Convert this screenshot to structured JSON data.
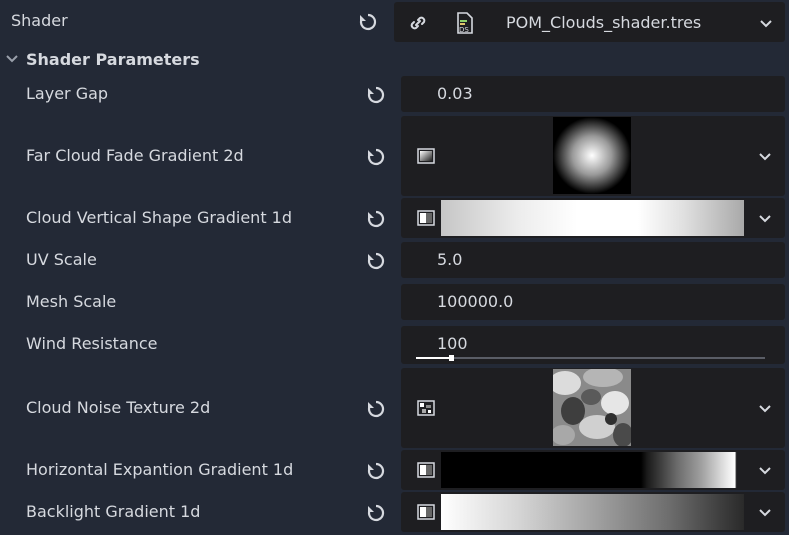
{
  "shader": {
    "label": "Shader",
    "resource_name": "POM_Clouds_shader.tres",
    "icons": [
      "revert-icon",
      "link-icon",
      "shader-file-icon",
      "chevron-down-icon"
    ]
  },
  "section": {
    "title": "Shader Parameters",
    "icon": "chevron-down-icon"
  },
  "params": {
    "layer_gap": {
      "label": "Layer Gap",
      "value": "0.03"
    },
    "far_cloud": {
      "label": "Far Cloud Fade Gradient 2d"
    },
    "cloud_vertical": {
      "label": "Cloud Vertical Shape Gradient 1d"
    },
    "uv_scale": {
      "label": "UV Scale",
      "value": "5.0"
    },
    "mesh_scale": {
      "label": "Mesh Scale",
      "value": "100000.0"
    },
    "wind_resistance": {
      "label": "Wind Resistance",
      "value": "100",
      "slider_fraction": 0.1
    },
    "cloud_noise": {
      "label": "Cloud Noise Texture 2d"
    },
    "horizontal_expansion": {
      "label": "Horizontal Expantion Gradient 1d"
    },
    "backlight": {
      "label": "Backlight Gradient 1d"
    }
  },
  "colors": {
    "panel_bg": "#232936",
    "field_bg": "#1e1e21",
    "text": "#d6d9df"
  }
}
